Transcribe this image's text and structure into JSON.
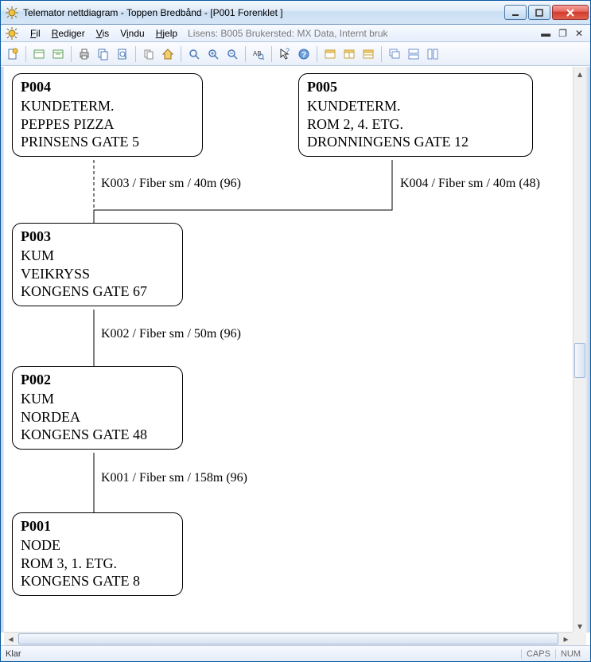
{
  "title": "Telemator nettdiagram - Toppen Bredbånd - [P001 Forenklet ]",
  "menu": {
    "fil": "Fil",
    "rediger": "Rediger",
    "vis": "Vis",
    "vindu": "Vindu",
    "hjelp": "Hjelp"
  },
  "license": "Lisens: B005 Brukersted: MX Data, Internt bruk",
  "status": {
    "ready": "Klar",
    "caps": "CAPS",
    "num": "NUM"
  },
  "nodes": {
    "p004": {
      "id": "P004",
      "l1": "KUNDETERM.",
      "l2": "PEPPES PIZZA",
      "l3": "PRINSENS GATE 5"
    },
    "p005": {
      "id": "P005",
      "l1": "KUNDETERM.",
      "l2": "ROM 2, 4. ETG.",
      "l3": "DRONNINGENS GATE 12"
    },
    "p003": {
      "id": "P003",
      "l1": "KUM",
      "l2": "VEIKRYSS",
      "l3": "KONGENS GATE 67"
    },
    "p002": {
      "id": "P002",
      "l1": "KUM",
      "l2": "NORDEA",
      "l3": "KONGENS GATE 48"
    },
    "p001": {
      "id": "P001",
      "l1": "NODE",
      "l2": "ROM 3, 1. ETG.",
      "l3": "KONGENS GATE 8"
    }
  },
  "edges": {
    "k003": "K003 / Fiber sm / 40m (96)",
    "k004": "K004 / Fiber sm / 40m (48)",
    "k002": "K002 / Fiber sm / 50m (96)",
    "k001": "K001 / Fiber sm / 158m (96)"
  },
  "diagram_data": {
    "type": "network-topology",
    "nodes": [
      {
        "id": "P004",
        "type": "KUNDETERM.",
        "name": "PEPPES PIZZA",
        "address": "PRINSENS GATE 5"
      },
      {
        "id": "P005",
        "type": "KUNDETERM.",
        "name": "ROM 2, 4. ETG.",
        "address": "DRONNINGENS GATE 12"
      },
      {
        "id": "P003",
        "type": "KUM",
        "name": "VEIKRYSS",
        "address": "KONGENS GATE 67"
      },
      {
        "id": "P002",
        "type": "KUM",
        "name": "NORDEA",
        "address": "KONGENS GATE 48"
      },
      {
        "id": "P001",
        "type": "NODE",
        "name": "ROM 3, 1. ETG.",
        "address": "KONGENS GATE 8"
      }
    ],
    "edges": [
      {
        "id": "K003",
        "from": "P004",
        "to": "P003",
        "fiber": "Fiber sm",
        "length_m": 40,
        "count": 96,
        "style": "dashed"
      },
      {
        "id": "K004",
        "from": "P005",
        "to": "P003",
        "fiber": "Fiber sm",
        "length_m": 40,
        "count": 48,
        "style": "solid"
      },
      {
        "id": "K002",
        "from": "P003",
        "to": "P002",
        "fiber": "Fiber sm",
        "length_m": 50,
        "count": 96,
        "style": "solid"
      },
      {
        "id": "K001",
        "from": "P002",
        "to": "P001",
        "fiber": "Fiber sm",
        "length_m": 158,
        "count": 96,
        "style": "solid"
      }
    ]
  }
}
